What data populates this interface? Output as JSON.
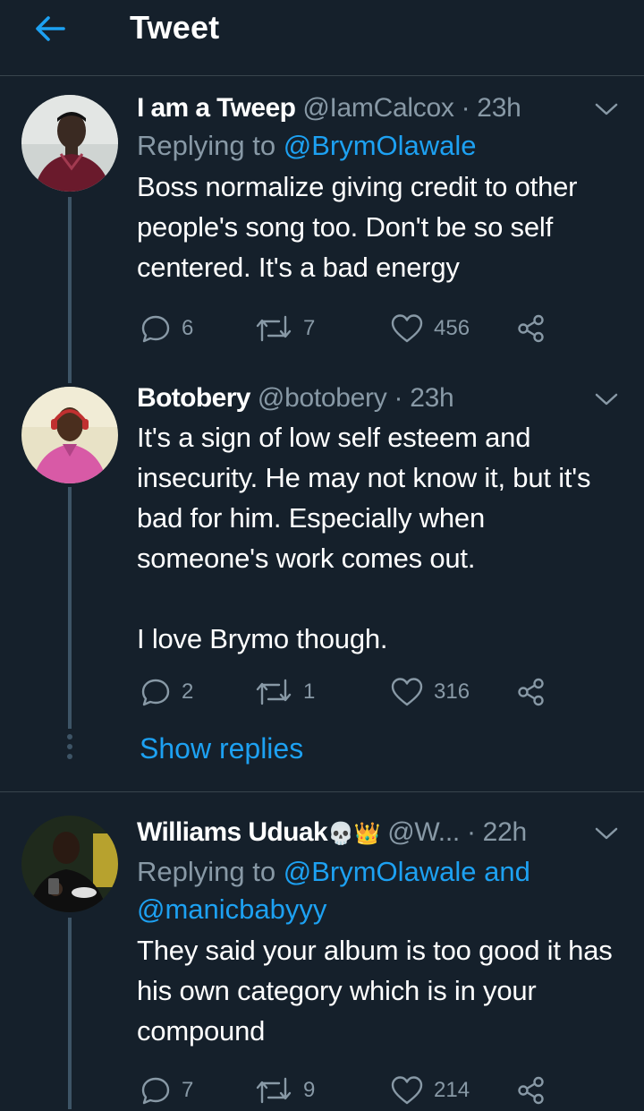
{
  "header": {
    "title": "Tweet",
    "back_icon": "arrow-left-icon",
    "accent": "#1da1f2"
  },
  "tweets": [
    {
      "name": "I am a Tweep",
      "handle": "@IamCalcox",
      "time": "· 23h",
      "replying_prefix": "Replying to ",
      "replying_to": "@BrymOlawale",
      "text": "Boss normalize giving credit to other people's song too. Don't be so self centered. It's a bad energy",
      "replies": "6",
      "retweets": "7",
      "likes": "456"
    },
    {
      "name": "Botobery",
      "handle": "@botobery",
      "time": "· 23h",
      "text_lines": [
        "It's a sign of low self esteem and insecurity. He may not know it, but it's bad for him. Especially when someone's work comes out.",
        "I love Brymo though."
      ],
      "replies": "2",
      "retweets": "1",
      "likes": "316",
      "show_replies": "Show replies"
    },
    {
      "name": "Williams Uduak",
      "name_emoji": "💀👑",
      "handle": "@W...",
      "time": "· 22h",
      "replying_prefix": "Replying to ",
      "replying_to": "@BrymOlawale and @manicbabyyy",
      "text": "They said your album is too good it has his own category which is in your compound",
      "replies": "7",
      "retweets": "9",
      "likes": "214"
    }
  ]
}
